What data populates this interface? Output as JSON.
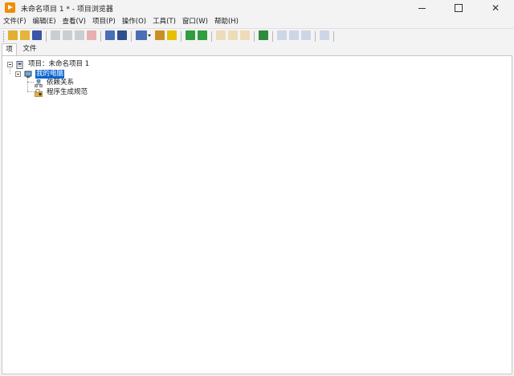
{
  "window": {
    "title": "未命名项目 1 * - 项目浏览器",
    "controls": {
      "minimize": "—",
      "maximize": "□",
      "close": "✕"
    }
  },
  "menu": [
    "文件(F)",
    "编辑(E)",
    "查看(V)",
    "项目(P)",
    "操作(O)",
    "工具(T)",
    "窗口(W)",
    "帮助(H)"
  ],
  "toolbar": {
    "buttons": [
      {
        "icon": "new-icon",
        "color": "#e0b030"
      },
      {
        "icon": "open-folder-icon",
        "color": "#e5b43a"
      },
      {
        "icon": "save-all-icon",
        "color": "#3b55a8"
      },
      {
        "icon": "cut-icon",
        "color": "#9aa0a8"
      },
      {
        "icon": "copy-icon",
        "color": "#9aa0a8"
      },
      {
        "icon": "paste-icon",
        "color": "#9aa0a8"
      },
      {
        "icon": "delete-icon",
        "color": "#d86060"
      },
      {
        "icon": "build-icon",
        "color": "#4a6fb5"
      },
      {
        "icon": "deploy-icon",
        "color": "#2f4f8f"
      },
      {
        "icon": "view-icon",
        "color": "#4a6fb5"
      },
      {
        "icon": "resolve-conflicts-icon",
        "color": "#c89020"
      },
      {
        "icon": "warning-icon",
        "color": "#e6c000"
      },
      {
        "icon": "add-icon",
        "color": "#2e9e3e"
      },
      {
        "icon": "add-folder-icon",
        "color": "#2e9e3e"
      },
      {
        "icon": "sort-icon",
        "color": "#e8c070"
      },
      {
        "icon": "auto-populate-icon",
        "color": "#e8c070"
      },
      {
        "icon": "edit-icon",
        "color": "#e8c070"
      },
      {
        "icon": "labview-icon",
        "color": "#2e8b3e"
      },
      {
        "icon": "collapse-icon",
        "color": "#9fb4d8"
      },
      {
        "icon": "refresh-icon",
        "color": "#9fb4d8"
      },
      {
        "icon": "expand-icon",
        "color": "#9fb4d8"
      },
      {
        "icon": "find-icon",
        "color": "#9fb4d8"
      }
    ]
  },
  "tabs": [
    "项",
    "文件"
  ],
  "tree": {
    "root": "项目：未命名项目 1",
    "computer": "我的电脑",
    "children": [
      "依赖关系",
      "程序生成规范"
    ]
  },
  "colors": {
    "accent": "#0a64d2",
    "app_icon": "#f28c00"
  }
}
